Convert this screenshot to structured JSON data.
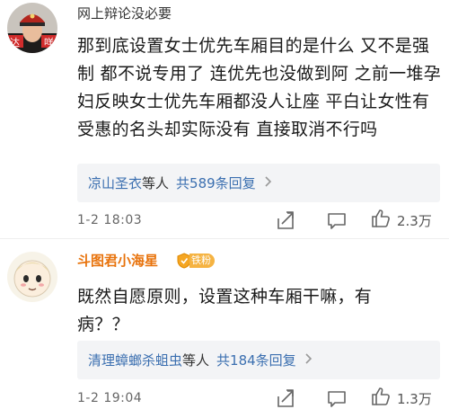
{
  "comments": [
    {
      "username": "网上辩论没必要",
      "content": "那到底设置女士优先车厢目的是什么 又不是强制 都不说专用了 连优先也没做到阿 之前一堆孕妇反映女士优先车厢都没人让座 平白让女性有受惠的名头却实际没有 直接取消不行吗",
      "replies": {
        "name": "凉山圣衣",
        "suffix": "等人",
        "count_text": "共589条回复"
      },
      "timestamp": "1-2 18:03",
      "likes": "2.3万",
      "avatar_name": "avatar-photo"
    },
    {
      "username": "斗图君小海星",
      "badge": "铁粉",
      "content": "既然自愿原则，设置这种车厢干嘛，有病？？",
      "replies": {
        "name": "清理蟑螂杀蛆虫",
        "suffix": "等人",
        "count_text": "共184条回复"
      },
      "timestamp": "1-2 19:04",
      "likes": "1.3万",
      "avatar_name": "avatar-cartoon"
    }
  ],
  "icons": {
    "share": "share-icon",
    "comment": "comment-icon",
    "like": "thumbs-up-icon",
    "chevron": "chevron-right-icon"
  },
  "colors": {
    "link": "#3b6fb0",
    "username_highlight": "#e8730c",
    "badge": "#f5b342",
    "reply_bg": "#f3f4f6"
  }
}
